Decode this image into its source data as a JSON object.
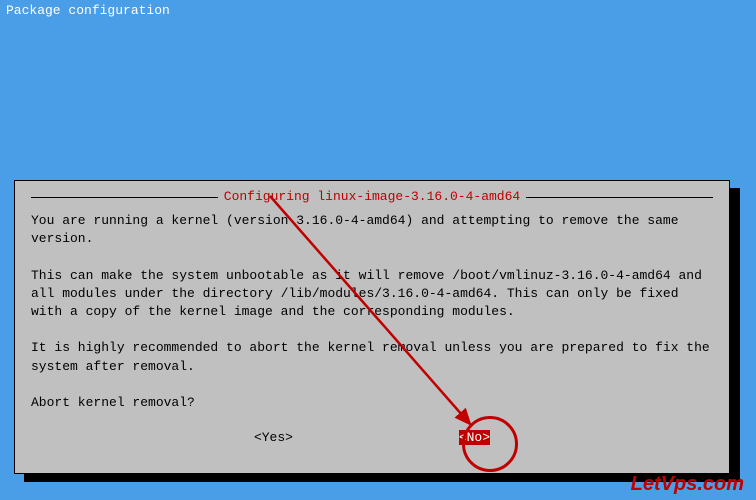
{
  "header": {
    "title": "Package configuration"
  },
  "dialog": {
    "title": "Configuring linux-image-3.16.0-4-amd64",
    "body": "You are running a kernel (version 3.16.0-4-amd64) and attempting to remove the same version.\n\nThis can make the system unbootable as it will remove /boot/vmlinuz-3.16.0-4-amd64 and all modules under the directory /lib/modules/3.16.0-4-amd64. This can only be fixed with a copy of the kernel image and the corresponding modules.\n\nIt is highly recommended to abort the kernel removal unless you are prepared to fix the system after removal.\n\nAbort kernel removal?",
    "buttons": {
      "yes": "<Yes>",
      "no": "<No>"
    }
  },
  "watermark": "LetVps.com"
}
